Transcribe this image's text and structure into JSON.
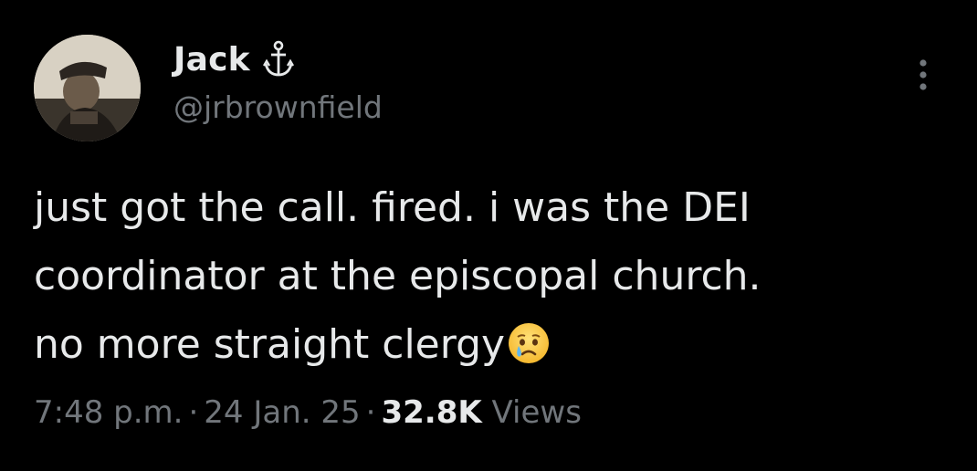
{
  "author": {
    "display_name": "Jack",
    "handle": "@jrbrownfield",
    "name_badge_icon": "anchor-icon",
    "avatar_icon": "user-photo"
  },
  "menu": {
    "icon": "more-vertical-icon"
  },
  "tweet": {
    "lines": [
      "just got the call. fired. i was the DEI",
      "coordinator at the episcopal church.",
      "no more straight clergy"
    ],
    "trailing_emoji": "crying-face-emoji"
  },
  "meta": {
    "time": "7:48 p.m.",
    "separator": "·",
    "date": "24 Jan. 25",
    "views_count": "32.8K",
    "views_label": "Views"
  },
  "colors": {
    "background": "#000000",
    "primary_text": "#e7e9ea",
    "secondary_text": "#71767b"
  }
}
